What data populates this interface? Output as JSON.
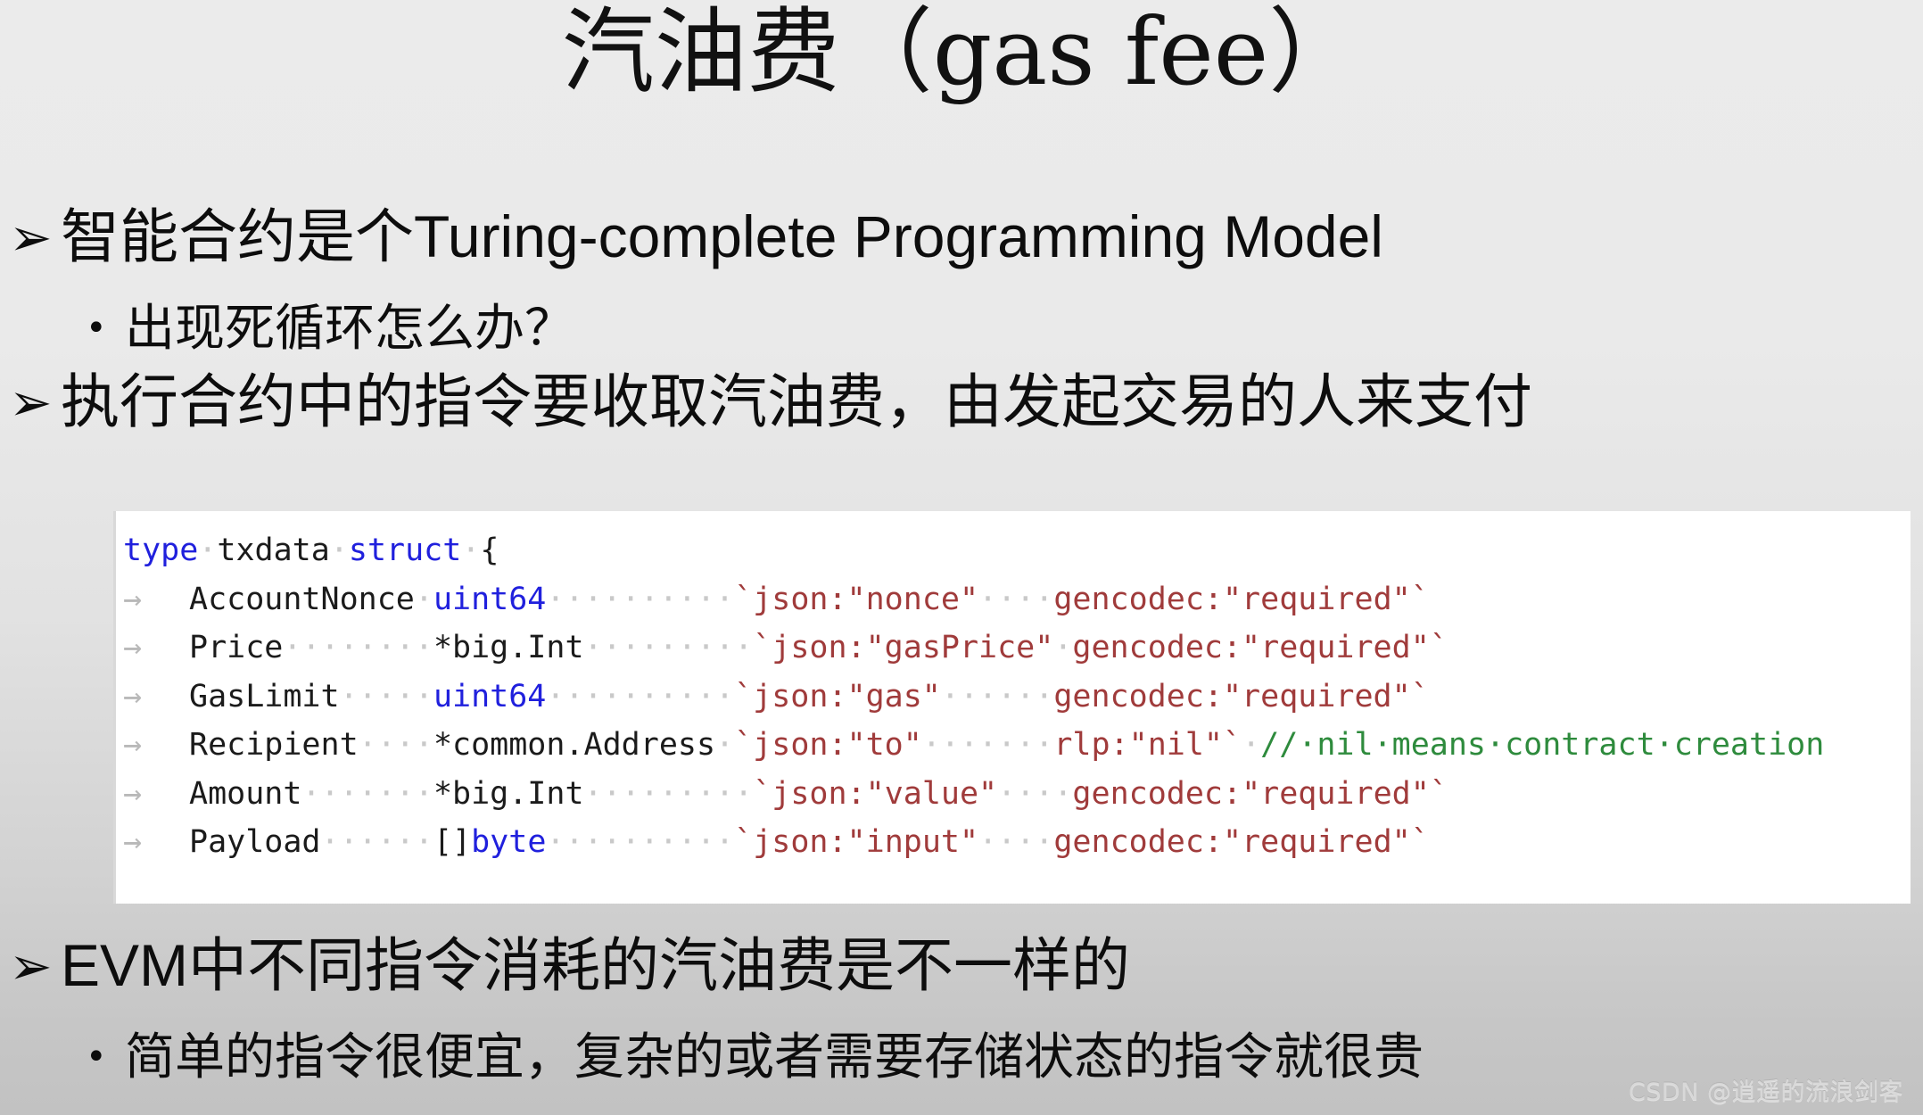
{
  "slide": {
    "title": "汽油费（gas fee）",
    "background_top_color": "#ebebeb",
    "background_bottom_color": "#c2c2c2"
  },
  "bullets": [
    {
      "level": 1,
      "marker": "➢",
      "text_cn": "智能合约是个",
      "text_en": "Turing-complete Programming Model",
      "full_text": "智能合约是个Turing-complete Programming Model"
    },
    {
      "level": 2,
      "marker": "•",
      "text_cn": "出现死循环怎么办？",
      "text_en": "",
      "full_text": "出现死循环怎么办？"
    },
    {
      "level": 1,
      "marker": "➢",
      "text_cn": "执行合约中的指令要收取汽油费，由发起交易的人来支付",
      "text_en": "",
      "full_text": "执行合约中的指令要收取汽油费，由发起交易的人来支付"
    },
    {
      "level": 1,
      "marker": "➢",
      "text_cn": "中不同指令消耗的汽油费是不一样的",
      "text_en": "EVM",
      "full_text": "EVM中不同指令消耗的汽油费是不一样的"
    },
    {
      "level": 2,
      "marker": "•",
      "text_cn": "简单的指令很便宜，复杂的或者需要存储状态的指令就很贵",
      "text_en": "",
      "full_text": "简单的指令很便宜，复杂的或者需要存储状态的指令就很贵"
    }
  ],
  "code_block": {
    "language": "go",
    "background": "#ffffff",
    "colors": {
      "keyword": "#2020dd",
      "type": "#2020dd",
      "plain": "#1b1b1b",
      "tag_string": "#a03b3b",
      "comment": "#2e8b3d",
      "whitespace_dot": "#c9c9c9",
      "tab_arrow": "#b9b9b9"
    },
    "lines": [
      {
        "indent_arrow": false,
        "tokens": [
          {
            "t": "type",
            "c": "kw"
          },
          {
            "t": "·",
            "c": "dots"
          },
          {
            "t": "txdata",
            "c": "plain"
          },
          {
            "t": "·",
            "c": "dots"
          },
          {
            "t": "struct",
            "c": "kw"
          },
          {
            "t": "·",
            "c": "dots"
          },
          {
            "t": "{",
            "c": "plain"
          }
        ]
      },
      {
        "indent_arrow": true,
        "tokens": [
          {
            "t": "AccountNonce",
            "c": "plain"
          },
          {
            "t": "·",
            "c": "dots"
          },
          {
            "t": "uint64",
            "c": "typ"
          },
          {
            "t": "··········",
            "c": "dots"
          },
          {
            "t": "`json:\"nonce\"",
            "c": "tag"
          },
          {
            "t": "····",
            "c": "dots"
          },
          {
            "t": "gencodec:\"required\"`",
            "c": "tag"
          }
        ]
      },
      {
        "indent_arrow": true,
        "tokens": [
          {
            "t": "Price",
            "c": "plain"
          },
          {
            "t": "········",
            "c": "dots"
          },
          {
            "t": "*big.Int",
            "c": "plain"
          },
          {
            "t": "·········",
            "c": "dots"
          },
          {
            "t": "`json:\"gasPrice\"",
            "c": "tag"
          },
          {
            "t": "·",
            "c": "dots"
          },
          {
            "t": "gencodec:\"required\"`",
            "c": "tag"
          }
        ]
      },
      {
        "indent_arrow": true,
        "tokens": [
          {
            "t": "GasLimit",
            "c": "plain"
          },
          {
            "t": "·····",
            "c": "dots"
          },
          {
            "t": "uint64",
            "c": "typ"
          },
          {
            "t": "··········",
            "c": "dots"
          },
          {
            "t": "`json:\"gas\"",
            "c": "tag"
          },
          {
            "t": "······",
            "c": "dots"
          },
          {
            "t": "gencodec:\"required\"`",
            "c": "tag"
          }
        ]
      },
      {
        "indent_arrow": true,
        "tokens": [
          {
            "t": "Recipient",
            "c": "plain"
          },
          {
            "t": "····",
            "c": "dots"
          },
          {
            "t": "*common.Address",
            "c": "plain"
          },
          {
            "t": "·",
            "c": "dots"
          },
          {
            "t": "`json:\"to\"",
            "c": "tag"
          },
          {
            "t": "·······",
            "c": "dots"
          },
          {
            "t": "rlp:\"nil\"`",
            "c": "tag"
          },
          {
            "t": "·",
            "c": "dots"
          },
          {
            "t": "//·nil·means·contract·creation",
            "c": "cmt"
          }
        ]
      },
      {
        "indent_arrow": true,
        "tokens": [
          {
            "t": "Amount",
            "c": "plain"
          },
          {
            "t": "·······",
            "c": "dots"
          },
          {
            "t": "*big.Int",
            "c": "plain"
          },
          {
            "t": "·········",
            "c": "dots"
          },
          {
            "t": "`json:\"value\"",
            "c": "tag"
          },
          {
            "t": "····",
            "c": "dots"
          },
          {
            "t": "gencodec:\"required\"`",
            "c": "tag"
          }
        ]
      },
      {
        "indent_arrow": true,
        "tokens": [
          {
            "t": "Payload",
            "c": "plain"
          },
          {
            "t": "······",
            "c": "dots"
          },
          {
            "t": "[]",
            "c": "plain"
          },
          {
            "t": "byte",
            "c": "typ"
          },
          {
            "t": "··········",
            "c": "dots"
          },
          {
            "t": "`json:\"input\"",
            "c": "tag"
          },
          {
            "t": "····",
            "c": "dots"
          },
          {
            "t": "gencodec:\"required\"`",
            "c": "tag"
          }
        ]
      }
    ]
  },
  "watermark": {
    "text": "CSDN @逍遥的流浪剑客"
  }
}
